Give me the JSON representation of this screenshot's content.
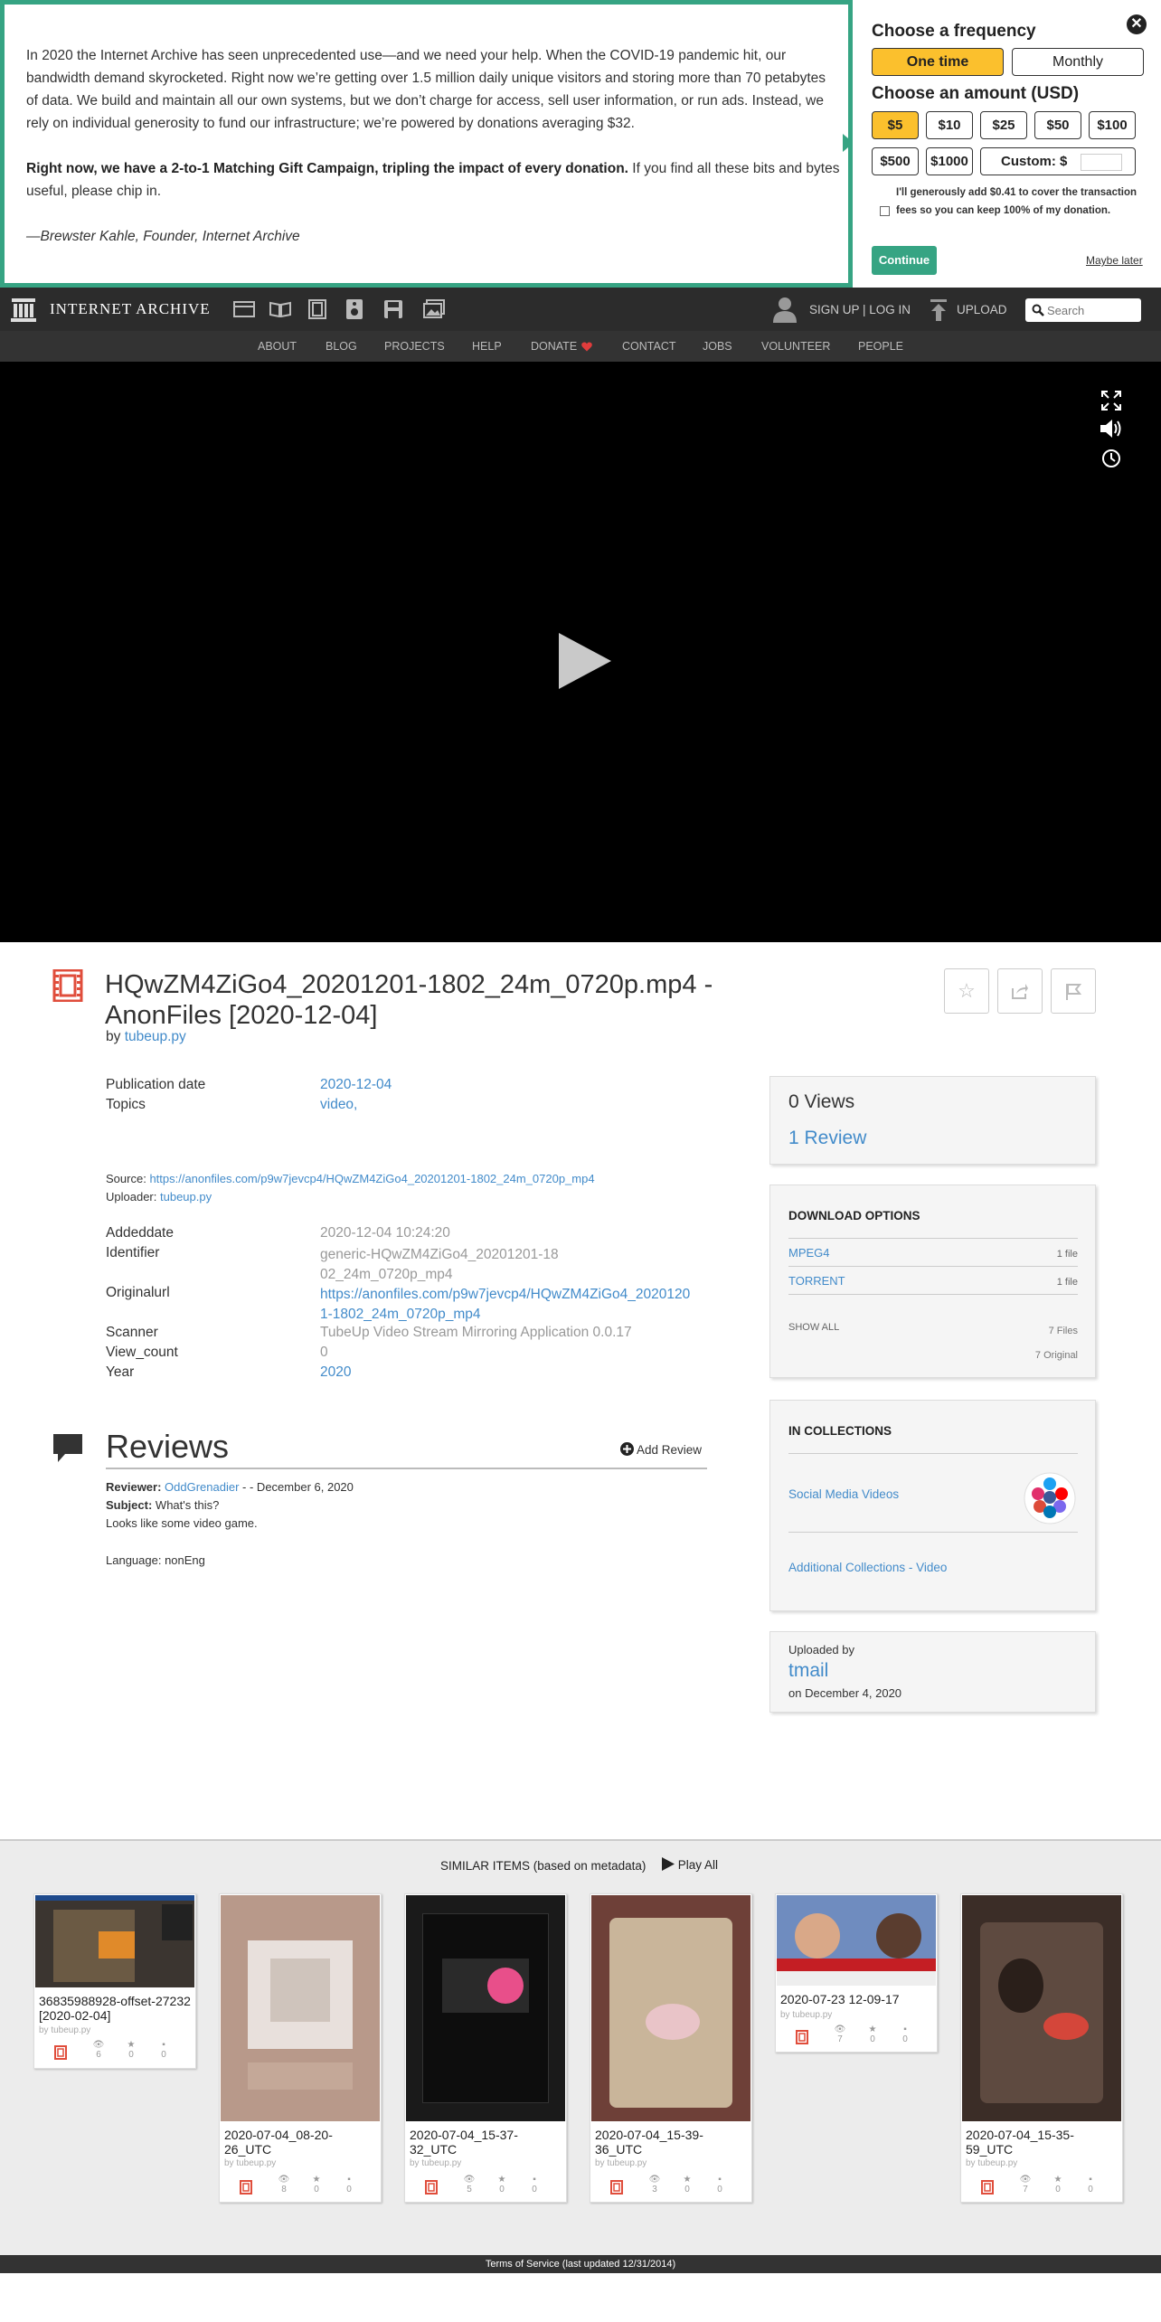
{
  "banner": {
    "para1": "In 2020 the Internet Archive has seen unprecedented use—and we need your help. When the COVID-19 pandemic hit, our bandwidth demand skyrocketed. Right now we’re getting over 1.5 million daily unique visitors and storing more than 70 petabytes of data. We build and maintain all our own systems, but we don’t charge for access, sell user information, or run ads. Instead, we rely on individual generosity to fund our infrastructure; we’re powered by donations averaging $32.",
    "para2_bold": "Right now, we have a 2-to-1 Matching Gift Campaign, tripling the impact of every donation.",
    "para2_rest": " If you find all these bits and bytes useful, please chip in.",
    "signature": "—Brewster Kahle, Founder, Internet Archive",
    "frequency_title": "Choose a frequency",
    "freq_one_time": "One time",
    "freq_monthly": "Monthly",
    "amount_title": "Choose an amount (USD)",
    "amounts": [
      "$5",
      "$10",
      "$25",
      "$50",
      "$100",
      "$500",
      "$1000"
    ],
    "custom_label": "Custom: $",
    "fee_text": "I'll generously add $0.41 to cover the transaction fees so you can keep 100% of my donation.",
    "continue": "Continue",
    "maybe_later": "Maybe later",
    "close": "✕",
    "accent": "#36a483",
    "selected": "#fbc02d"
  },
  "topnav": {
    "logo": "INTERNET ARCHIVE",
    "signup": "SIGN UP | LOG IN",
    "upload": "UPLOAD",
    "search_placeholder": "Search"
  },
  "subnav": [
    "ABOUT",
    "BLOG",
    "PROJECTS",
    "HELP",
    "DONATE",
    "CONTACT",
    "JOBS",
    "VOLUNTEER",
    "PEOPLE"
  ],
  "item": {
    "title": "HQwZM4ZiGo4_20201201-1802_24m_0720p.mp4 - AnonFiles [2020-12-04]",
    "by_label": "by",
    "creator": "tubeup.py",
    "pub_date_label": "Publication date",
    "pub_date": "2020-12-04",
    "topics_label": "Topics",
    "topics": "video,",
    "source_label": "Source:",
    "source": "https://anonfiles.com/p9w7jevcp4/HQwZM4ZiGo4_20201201-1802_24m_0720p_mp4",
    "uploader_label": "Uploader:",
    "uploader": "tubeup.py",
    "meta": [
      {
        "label": "Addeddate",
        "value": "2020-12-04 10:24:20"
      },
      {
        "label": "Identifier",
        "value": "generic-HQwZM4ZiGo4_20201201-1802_24m_0720p_mp4"
      },
      {
        "label": "Originalurl",
        "value": "https://anonfiles.com/p9w7jevcp4/HQwZM4ZiGo4_20201201-1802_24m_0720p_mp4"
      },
      {
        "label": "Scanner",
        "value": "TubeUp Video Stream Mirroring Application 0.0.17"
      },
      {
        "label": "View_count",
        "value": "0"
      },
      {
        "label": "Year",
        "value": "2020"
      }
    ]
  },
  "reviews": {
    "heading": "Reviews",
    "add": "Add Review",
    "reviewer_label": "Reviewer:",
    "reviewer": "OddGrenadier",
    "date": " - - December 6, 2020",
    "subject_label": "Subject:",
    "subject": "What's this?",
    "body": "Looks like some video game.",
    "language": "Language: nonEng"
  },
  "side": {
    "views": "0 Views",
    "review_count": "1 Review",
    "download_title": "DOWNLOAD OPTIONS",
    "downloads": [
      {
        "name": "MPEG4",
        "count": "1 file"
      },
      {
        "name": "TORRENT",
        "count": "1 file"
      }
    ],
    "show_all": "SHOW ALL",
    "files": "7 Files",
    "original": "7 Original",
    "collections_title": "IN COLLECTIONS",
    "collection1": "Social Media Videos",
    "collection2": "Additional Collections - Video",
    "uploaded_by_label": "Uploaded by",
    "uploaded_by": "tmail",
    "uploaded_on": "on December 4, 2020"
  },
  "similar": {
    "heading": "SIMILAR ITEMS (based on metadata)",
    "play_all": "Play All",
    "cards": [
      {
        "title": "36835988928-offset-27232 [2020-02-04]",
        "by": "by tubeup.py",
        "views": "6",
        "favs": "0",
        "reviews": "0"
      },
      {
        "title": "2020-07-04_08-20-26_UTC",
        "by": "by tubeup.py",
        "views": "8",
        "favs": "0",
        "reviews": "0"
      },
      {
        "title": "2020-07-04_15-37-32_UTC",
        "by": "by tubeup.py",
        "views": "5",
        "favs": "0",
        "reviews": "0"
      },
      {
        "title": "2020-07-04_15-39-36_UTC",
        "by": "by tubeup.py",
        "views": "3",
        "favs": "0",
        "reviews": "0"
      },
      {
        "title": "2020-07-23 12-09-17",
        "by": "by tubeup.py",
        "views": "7",
        "favs": "0",
        "reviews": "0"
      },
      {
        "title": "2020-07-04_15-35-59_UTC",
        "by": "by tubeup.py",
        "views": "7",
        "favs": "0",
        "reviews": "0"
      }
    ]
  },
  "footer": "Terms of Service (last updated 12/31/2014)"
}
